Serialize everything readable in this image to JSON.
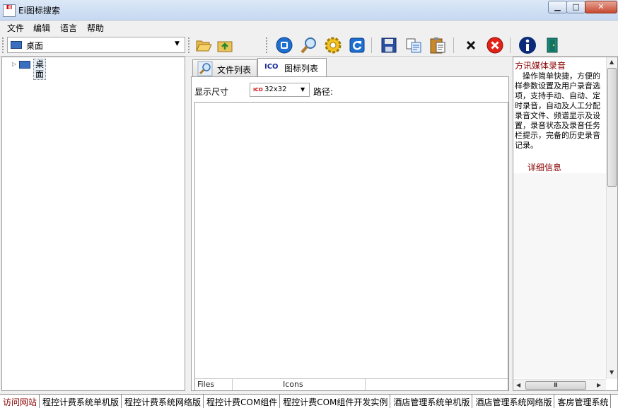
{
  "window": {
    "title": "Ei图标搜索",
    "app_icon_text": "EI",
    "caption_buttons": {
      "minimize": "▁",
      "maximize": "□",
      "close": "✕"
    }
  },
  "menu": [
    "文件",
    "编辑",
    "语言",
    "帮助"
  ],
  "toolbar": {
    "location_value": "桌面",
    "icons": [
      "open-folder-icon",
      "upload-folder-icon",
      "stop-icon",
      "search-icon",
      "settings-gear-icon",
      "refresh-icon",
      "save-disk-icon",
      "copy-icon",
      "clipboard-icon",
      "delete-x-icon",
      "cancel-red-icon",
      "info-icon",
      "exit-door-icon"
    ]
  },
  "tree": {
    "root_label": "桌面"
  },
  "tabs": [
    {
      "label": "文件列表"
    },
    {
      "label": "图标列表",
      "prefix": "ICO",
      "active": true
    }
  ],
  "icon_panel": {
    "size_label": "显示尺寸",
    "size_value": "32x32",
    "size_prefix": "ICO",
    "path_label": "路径:",
    "footer": {
      "files": "Files",
      "icons": "Icons"
    }
  },
  "ad_panel": {
    "title": "方讯媒体录音",
    "body": "　操作简单快捷，方便的样参数设置及用户录音选项，支持手动、自动、定时录音，自动及人工分配录音文件、频谱显示及设置，录音状态及录音任务栏提示，完备的历史录音记录。",
    "detail_link": "详细信息",
    "scroll_glyph": "Ⅲ"
  },
  "links": [
    "访问网站",
    "程控计费系统单机版",
    "程控计费系统网络版",
    "程控计费COM组件",
    "程控计费COM组件开发实例",
    "酒店管理系统单机版",
    "酒店管理系统网络版",
    "客房管理系统"
  ],
  "colors": {
    "accent_red": "#8b0000",
    "titlebar": "#c6d9f1",
    "background": "#f0f0f0"
  }
}
